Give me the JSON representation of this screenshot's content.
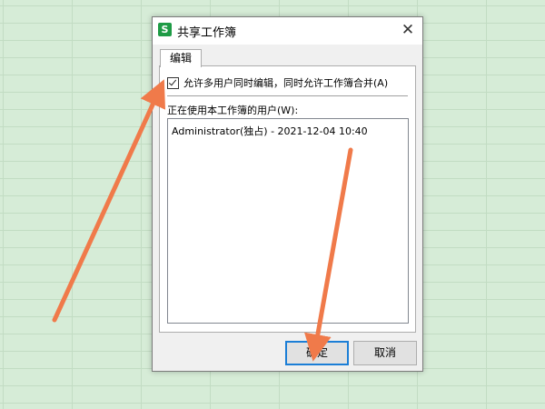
{
  "dialog": {
    "icon_glyph": "S",
    "title": "共享工作簿",
    "close_glyph": "✕",
    "tab_label": "编辑",
    "allow_multi_user_label": "允许多用户同时编辑，同时允许工作簿合并(A)",
    "allow_multi_user_checked": true,
    "users_label": "正在使用本工作簿的用户(W):",
    "users": [
      "Administrator(独占) - 2021-12-04 10:40"
    ],
    "ok_label": "确定",
    "cancel_label": "取消"
  },
  "colors": {
    "sheet_background": "#d6ecd7",
    "accent_arrow": "#f07a4a",
    "default_button_border": "#1b7ed6",
    "app_icon": "#1e9b45"
  }
}
